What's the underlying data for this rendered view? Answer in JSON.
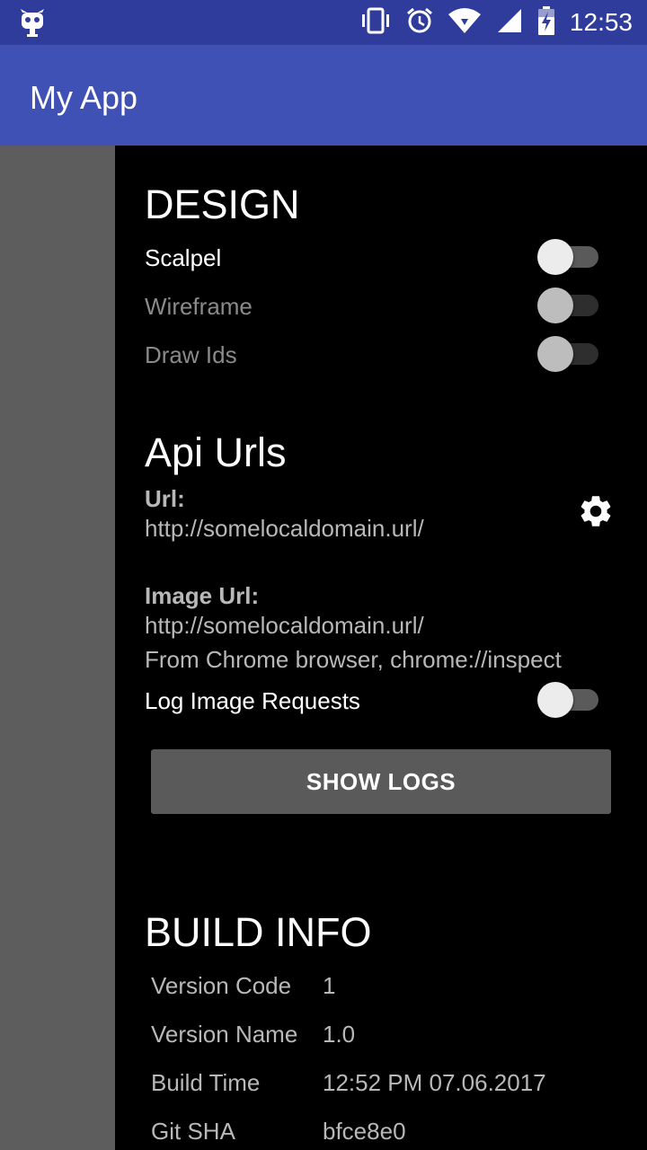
{
  "status_bar": {
    "time": "12:53",
    "icons": [
      "cyanogen-mod-icon",
      "vibrate-icon",
      "alarm-icon",
      "wifi-icon",
      "cell-signal-icon",
      "battery-charging-icon"
    ]
  },
  "app_bar": {
    "title": "My App"
  },
  "design": {
    "title": "DESIGN",
    "toggles": [
      {
        "label": "Scalpel",
        "enabled": true,
        "on": false
      },
      {
        "label": "Wireframe",
        "enabled": false,
        "on": false
      },
      {
        "label": "Draw Ids",
        "enabled": false,
        "on": false
      }
    ]
  },
  "api": {
    "title": "Api Urls",
    "url_label": "Url:",
    "url_value": "http://somelocaldomain.url/",
    "image_url_label": "Image Url:",
    "image_url_value": "http://somelocaldomain.url/",
    "inspect_hint": "From Chrome browser, chrome://inspect",
    "log_toggle": {
      "label": "Log Image Requests",
      "on": false
    },
    "show_logs_label": "SHOW LOGS"
  },
  "build_info": {
    "title": "BUILD INFO",
    "rows": [
      {
        "label": "Version Code",
        "value": "1"
      },
      {
        "label": "Version Name",
        "value": "1.0"
      },
      {
        "label": "Build Time",
        "value": "12:52 PM 07.06.2017"
      },
      {
        "label": "Git SHA",
        "value": "bfce8e0"
      }
    ]
  },
  "colors": {
    "status_bar": "#2f3c9c",
    "app_bar": "#3f51b5",
    "drawer_bg": "#000000",
    "scrim": "#5d5d5d"
  }
}
